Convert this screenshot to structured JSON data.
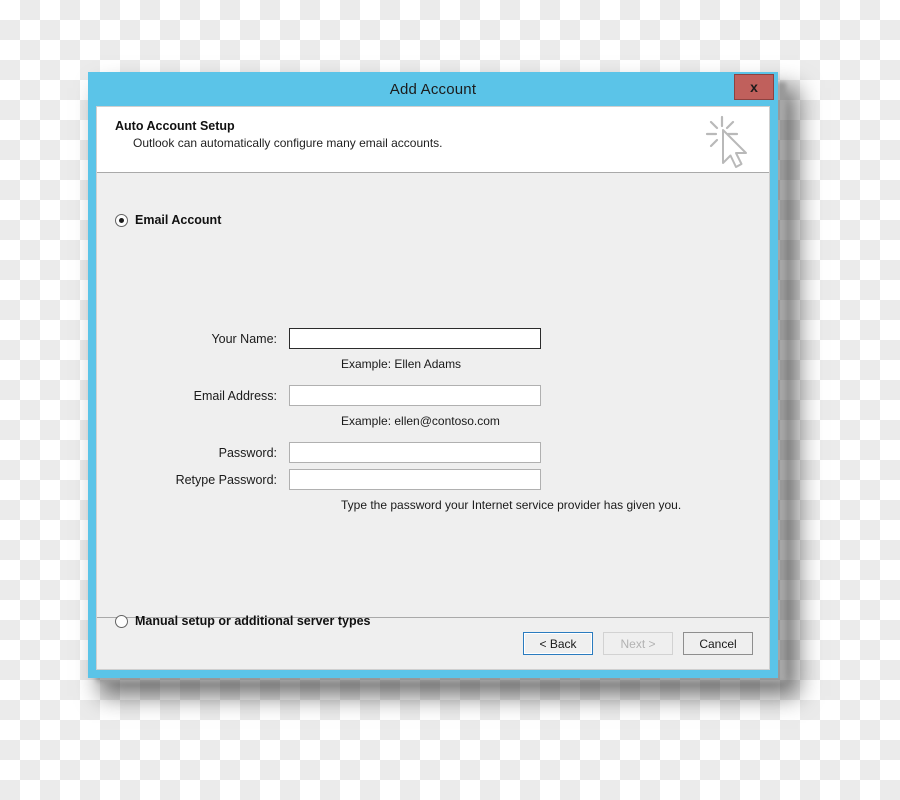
{
  "window": {
    "title": "Add Account",
    "close_label": "x",
    "accent_color": "#5bc4e8",
    "close_button_color": "#c0605c"
  },
  "header": {
    "title": "Auto Account Setup",
    "subtitle": "Outlook can automatically configure many email accounts.",
    "icon": "mouse-cursor-click-icon"
  },
  "options": {
    "email_account": {
      "label": "Email Account",
      "selected": true
    },
    "manual_setup": {
      "label": "Manual setup or additional server types",
      "selected": false
    }
  },
  "form": {
    "fields": [
      {
        "id": "your-name",
        "label": "Your Name:",
        "value": "",
        "placeholder": "",
        "hint": "Example: Ellen Adams",
        "focused": true,
        "type": "text"
      },
      {
        "id": "email-address",
        "label": "Email Address:",
        "value": "",
        "placeholder": "",
        "hint": "Example: ellen@contoso.com",
        "focused": false,
        "type": "text"
      },
      {
        "id": "password",
        "label": "Password:",
        "value": "",
        "placeholder": "",
        "hint": "",
        "focused": false,
        "type": "password"
      },
      {
        "id": "retype-password",
        "label": "Retype Password:",
        "value": "",
        "placeholder": "",
        "hint": "Type the password your Internet service provider has given you.",
        "focused": false,
        "type": "password"
      }
    ]
  },
  "footer": {
    "back_label": "< Back",
    "next_label": "Next >",
    "cancel_label": "Cancel",
    "back_focused": true,
    "next_disabled": true
  }
}
